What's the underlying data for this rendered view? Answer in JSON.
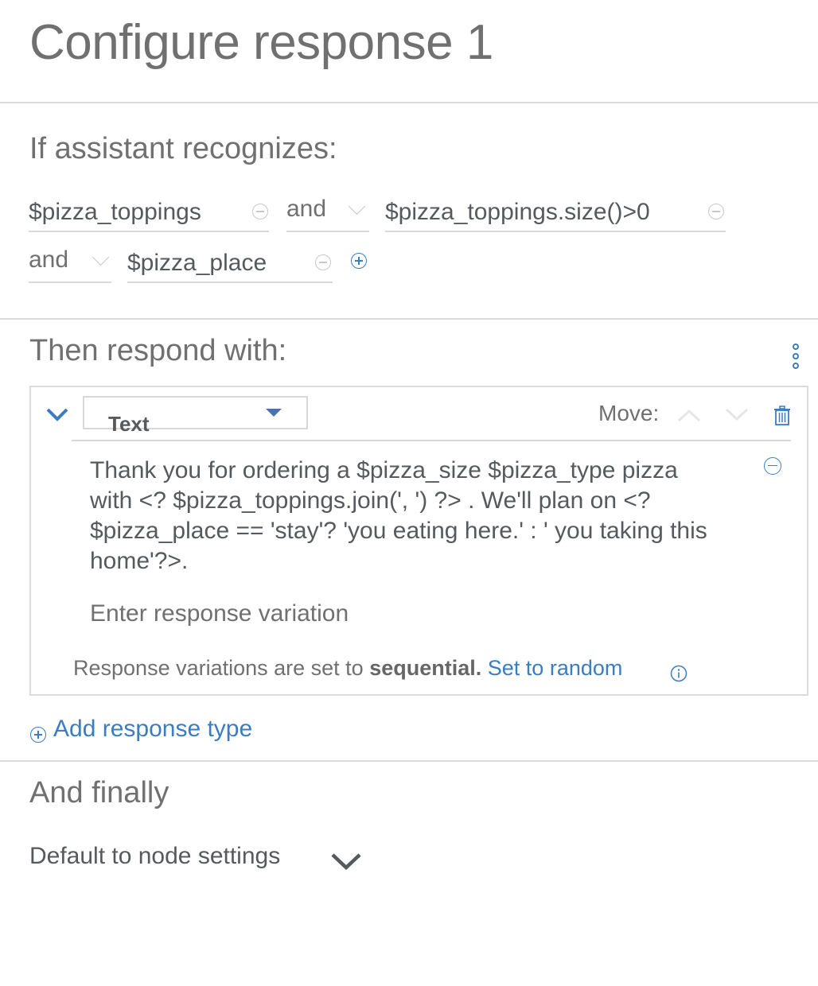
{
  "page": {
    "title": "Configure response 1"
  },
  "condition_section": {
    "heading": "If assistant recognizes:",
    "conditions": [
      {
        "value": "$pizza_toppings"
      },
      {
        "operator": "and",
        "value": "$pizza_toppings.size()>0"
      },
      {
        "operator": "and",
        "value": "$pizza_place"
      }
    ]
  },
  "response_section": {
    "heading": "Then respond with:",
    "response_type": {
      "selected": "Text"
    },
    "move_label": "Move:",
    "variations": [
      "Thank you for ordering a $pizza_size $pizza_type pizza with <? $pizza_toppings.join(', ') ?> . We'll plan on  <? $pizza_place == 'stay'? 'you eating here.' :  ' you taking this home'?>."
    ],
    "variation_placeholder": "Enter response variation",
    "variation_mode_prefix": "Response variations are set to",
    "variation_mode_value": "sequential.",
    "variation_mode_link": "Set to random",
    "add_response_type_label": "Add response type"
  },
  "finally_section": {
    "heading": "And finally",
    "action": "Default to node settings"
  },
  "colors": {
    "accent": "#3b7dc1",
    "text_primary": "#565a5c",
    "text_secondary": "#707070",
    "divider": "#dcdcdc"
  }
}
